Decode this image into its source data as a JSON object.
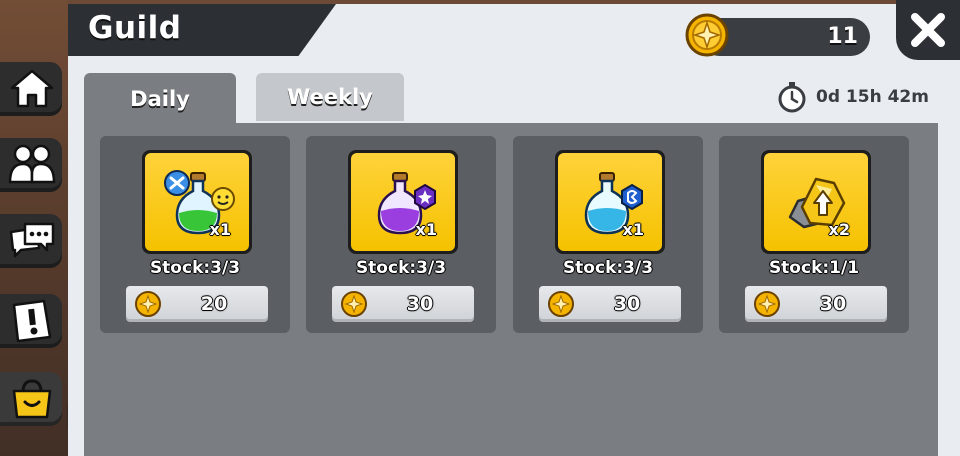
{
  "header": {
    "title": "Guild"
  },
  "currency": {
    "value": "11",
    "icon": "gold-coin-icon",
    "color": "#f5b400"
  },
  "tabs": [
    {
      "label": "Daily",
      "active": true
    },
    {
      "label": "Weekly",
      "active": false
    }
  ],
  "timer": {
    "text": "0d 15h 42m",
    "icon": "stopwatch-icon"
  },
  "nav": [
    {
      "icon": "home-icon"
    },
    {
      "icon": "friends-icon"
    },
    {
      "icon": "chat-icon"
    },
    {
      "icon": "alert-icon"
    },
    {
      "icon": "shop-bag-icon",
      "active": true
    }
  ],
  "items": [
    {
      "icon": "green-potion-icon",
      "qty": "x1",
      "stock": "Stock:3/3",
      "price": "20"
    },
    {
      "icon": "purple-potion-icon",
      "qty": "x1",
      "stock": "Stock:3/3",
      "price": "30"
    },
    {
      "icon": "blue-potion-icon",
      "qty": "x1",
      "stock": "Stock:3/3",
      "price": "30"
    },
    {
      "icon": "gold-upgrade-ore-icon",
      "qty": "x2",
      "stock": "Stock:1/1",
      "price": "30"
    }
  ]
}
